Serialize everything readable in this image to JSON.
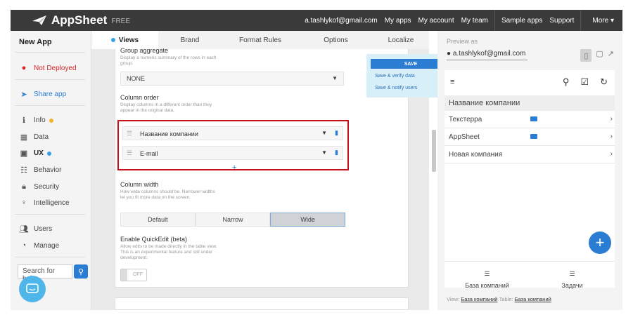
{
  "topbar": {
    "brand": "AppSheet",
    "brand_suffix": "FREE",
    "links": [
      "a.tashlykof@gmail.com",
      "My apps",
      "My account",
      "My team",
      "Sample apps",
      "Support"
    ],
    "more": "More ▾"
  },
  "sidebar": {
    "app_name": "New App",
    "status": "Not Deployed",
    "share": "Share app",
    "items": [
      {
        "label": "Info"
      },
      {
        "label": "Data"
      },
      {
        "label": "UX"
      },
      {
        "label": "Behavior"
      },
      {
        "label": "Security"
      },
      {
        "label": "Intelligence"
      },
      {
        "label": "Users"
      },
      {
        "label": "Manage"
      }
    ],
    "search_placeholder": "Search for help"
  },
  "tabs": [
    "Views",
    "Brand",
    "Format Rules",
    "Options",
    "Localize"
  ],
  "editor": {
    "group_aggregate_label": "Group aggregate",
    "group_aggregate_hint": "Display a numeric summary of the rows in each group.",
    "group_aggregate_value": "NONE",
    "column_order_label": "Column order",
    "column_order_hint": "Display columns in a different order than they appear in the original data.",
    "column_order": [
      "Название компании",
      "E-mail"
    ],
    "add_symbol": "+",
    "column_width_label": "Column width",
    "column_width_hint": "How wide columns should be. Narrower widths let you fit more data on the screen.",
    "width_options": [
      "Default",
      "Narrow",
      "Wide"
    ],
    "width_selected": "Wide",
    "quickedit_label": "Enable QuickEdit (beta)",
    "quickedit_hint": "Allow edits to be made directly in the table view. This is an experimental feature and still under development.",
    "quickedit_value": "OFF"
  },
  "save_menu": {
    "save": "SAVE",
    "verify": "Save & verify data",
    "notify": "Save & notify users"
  },
  "preview": {
    "label": "Preview as",
    "email": "a.tashlykof@gmail.com",
    "list_title": "Название компании",
    "rows": [
      "Текстерра",
      "AppSheet",
      "Новая компания"
    ],
    "nav": [
      {
        "label": "База компаний"
      },
      {
        "label": "Задачи"
      }
    ],
    "footer_view_label": "View:",
    "footer_view": "База компаний",
    "footer_table_label": "Table:",
    "footer_table": "База компаний"
  },
  "colors": {
    "accent": "#2a7dd2",
    "highlight_border": "#c80f1c",
    "not_deployed": "#d8232a",
    "info_dot": "#f0b429",
    "ux_dot": "#3aa0e6"
  }
}
